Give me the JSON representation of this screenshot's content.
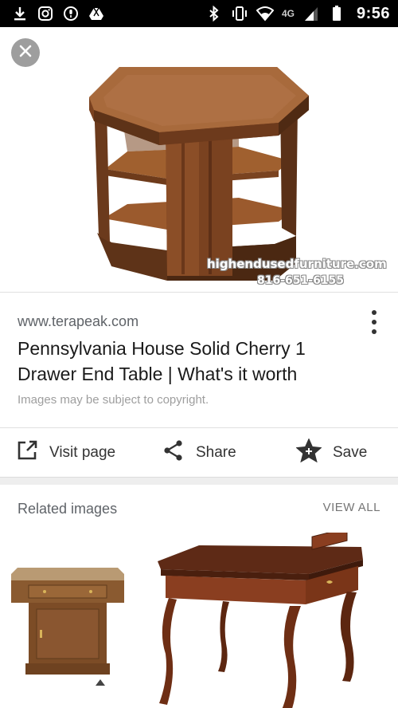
{
  "status_bar": {
    "time": "9:56",
    "network": "4G",
    "left_icons": [
      "download-icon",
      "instagram-icon",
      "podcast-icon",
      "drive-icon"
    ],
    "right_icons": [
      "bluetooth-icon",
      "vibrate-icon",
      "wifi-icon",
      "signal-icon",
      "battery-icon"
    ]
  },
  "hero": {
    "watermark_line1": "highendusedfurniture.com",
    "watermark_line2": "816-651-6155"
  },
  "result": {
    "source": "www.terapeak.com",
    "title": "Pennsylvania House Solid Cherry 1 Drawer End Table | What's it worth",
    "copyright": "Images may be subject to copyright."
  },
  "actions": {
    "visit_label": "Visit page",
    "share_label": "Share",
    "save_label": "Save"
  },
  "related": {
    "title": "Related images",
    "view_all": "VIEW ALL"
  },
  "colors": {
    "wood_dark": "#6b3a1c",
    "wood_mid": "#8a4e25",
    "wood_light": "#a8673a",
    "close_button": "#9e9e9e"
  }
}
